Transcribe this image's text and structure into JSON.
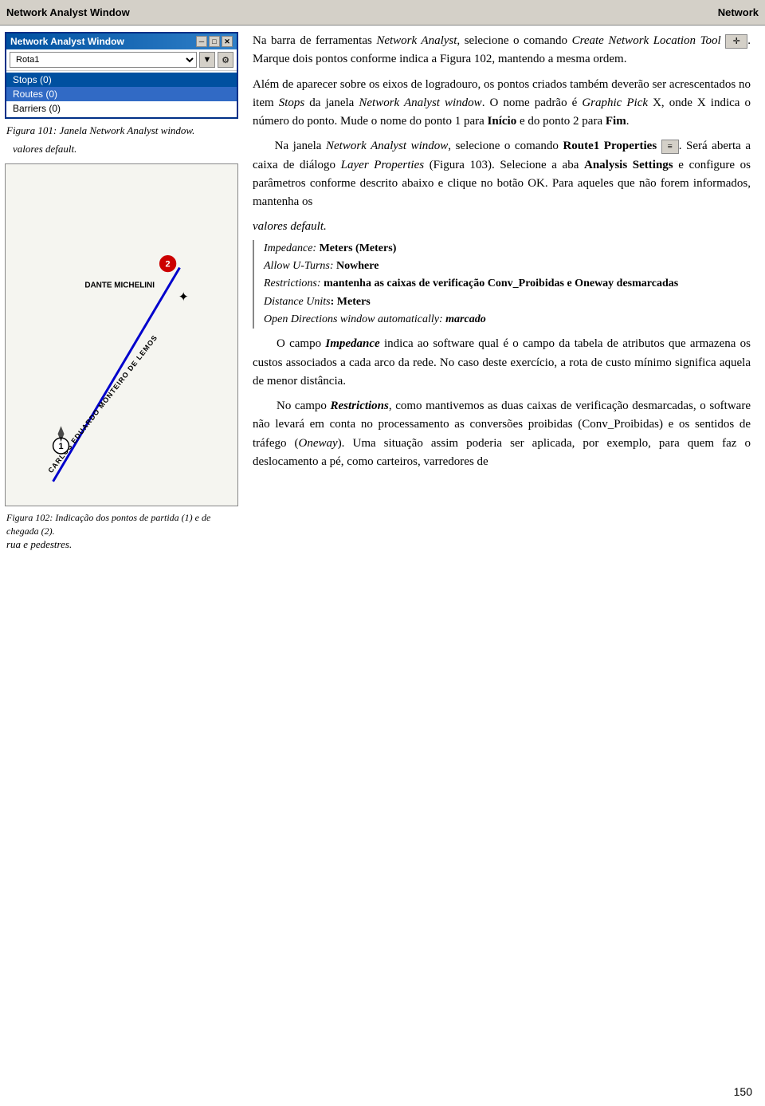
{
  "topbar": {
    "title": "Network Analyst Window",
    "right_label": "Network"
  },
  "naw": {
    "title": "Network Analyst Window",
    "dropdown_value": "Rota1",
    "items": [
      {
        "label": "Stops (0)",
        "state": "selected"
      },
      {
        "label": "Routes (0)",
        "state": "selected2"
      },
      {
        "label": "Barriers (0)",
        "state": "normal"
      }
    ],
    "close_btn": "✕",
    "min_btn": "─",
    "restore_btn": "□"
  },
  "fig101": {
    "caption": "Figura 101: Janela Network Analyst window.",
    "values_label": "valores default."
  },
  "fig102": {
    "caption": "Figura 102: Indicação dos pontos de partida (1) e de chegada (2)."
  },
  "bottom_left": {
    "label": "rua e pedestres."
  },
  "right_col": {
    "para1": "Na barra de ferramentas Network Analyst, selecione o comando Create Network Location Tool      .  Marque dois pontos conforme indica a Figura 102, mantendo a mesma ordem.",
    "para2": "Além de aparecer sobre os eixos de logradouro, os pontos criados também deverão ser acrescentados no item Stops da janela Network Analyst window.  O nome padrão é Graphic Pick X, onde X indica o número do ponto.  Mude o nome do ponto 1 para Início e do ponto 2 para Fim.",
    "para3": "Na janela Network Analyst window, selecione o comando Route1 Properties      .  Será aberta a caixa de diálogo Layer Properties (Figura 103).  Selecione a aba Analysis Settings e configure os parâmetros conforme descrito abaixo e clique no botão OK.  Para aqueles que não forem informados, mantenha os",
    "params": [
      {
        "label": "Impedance: ",
        "bold": "Meters (Meters)"
      },
      {
        "label": "Allow U-Turns: ",
        "bold": "Nowhere"
      },
      {
        "label": "Restrictions: ",
        "bold": "mantenha as caixas de verificação Conv_Proibidas e Oneway desmarcadas"
      },
      {
        "label": "Distance Units: ",
        "bold": "Meters"
      },
      {
        "label": "Open Directions window automatically: ",
        "bold": "marcado"
      }
    ],
    "para4_indent": "O campo Impedance indica ao software qual é o campo da tabela de atributos que armazena os custos associados a cada arco da rede. No caso deste exercício, a rota de custo mínimo significa aquela de menor distância.",
    "para5_indent": "No campo Restrictions, como mantivemos as duas caixas de verificação desmarcadas, o software não levará em conta no processamento as conversões proibidas (Conv_Proibidas) e os sentidos de tráfego (Oneway). Uma situação assim poderia ser aplicada, por exemplo, para quem faz o deslocamento a pé, como carteiros, varredores de"
  },
  "page_number": "150",
  "map": {
    "street1": "CARLOS EDUARDO MONTEIRO DE LEMOS",
    "street2": "DANTE MICHELINI",
    "point1_label": "1",
    "point2_label": "2"
  }
}
